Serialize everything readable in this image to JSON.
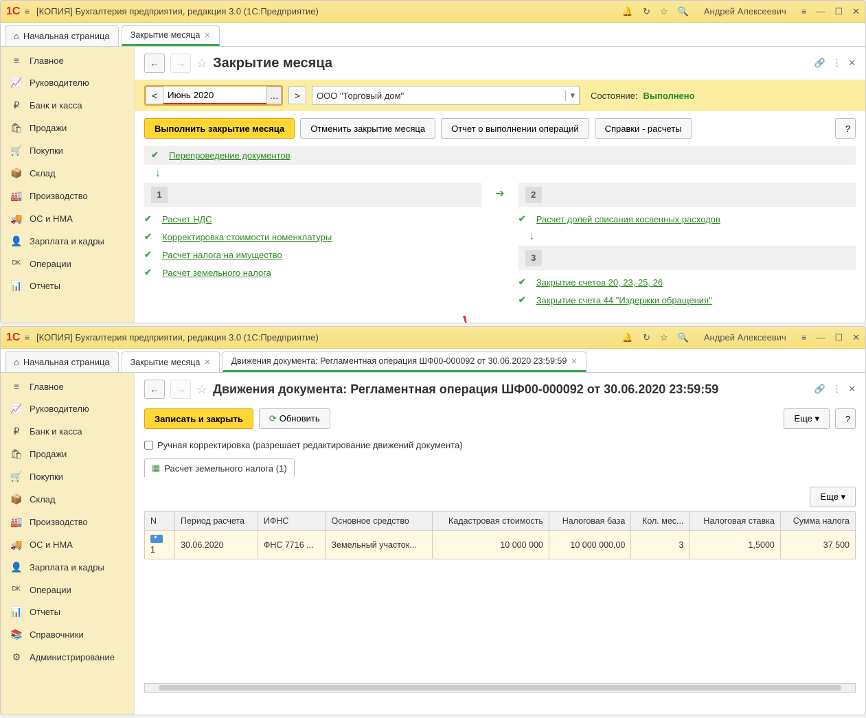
{
  "window_title": "[КОПИЯ] Бухгалтерия предприятия, редакция 3.0  (1С:Предприятие)",
  "user_name": "Андрей Алексеевич",
  "home_tab": "Начальная страница",
  "sidebar": {
    "items": [
      {
        "label": "Главное"
      },
      {
        "label": "Руководителю"
      },
      {
        "label": "Банк и касса"
      },
      {
        "label": "Продажи"
      },
      {
        "label": "Покупки"
      },
      {
        "label": "Склад"
      },
      {
        "label": "Производство"
      },
      {
        "label": "ОС и НМА"
      },
      {
        "label": "Зарплата и кадры"
      },
      {
        "label": "Операции"
      },
      {
        "label": "Отчеты"
      },
      {
        "label": "Справочники"
      },
      {
        "label": "Администрирование"
      }
    ]
  },
  "win1": {
    "tab": "Закрытие месяца",
    "page_title": "Закрытие месяца",
    "period": "Июнь 2020",
    "organization": "ООО \"Торговый дом\"",
    "status_label": "Состояние:",
    "status_value": "Выполнено",
    "buttons": {
      "execute": "Выполнить закрытие месяца",
      "cancel": "Отменить закрытие месяца",
      "report": "Отчет о выполнении операций",
      "refs": "Справки - расчеты"
    },
    "ops": {
      "reprov": "Перепроведение документов",
      "c1": {
        "o1": "Расчет НДС",
        "o2": "Корректировка стоимости номенклатуры",
        "o3": "Расчет налога на имущество",
        "o4": "Расчет земельного налога"
      },
      "c2": {
        "o1": "Расчет долей списания косвенных расходов"
      },
      "c3": {
        "o1": "Закрытие счетов 20, 23, 25, 26",
        "o2": "Закрытие счета 44 \"Издержки обращения\""
      }
    }
  },
  "win2": {
    "tab1": "Закрытие месяца",
    "tab2": "Движения документа: Регламентная операция ШФ00-000092 от 30.06.2020 23:59:59",
    "page_title": "Движения документа: Регламентная операция ШФ00-000092 от 30.06.2020 23:59:59",
    "buttons": {
      "save_close": "Записать и закрыть",
      "refresh": "Обновить",
      "more": "Еще"
    },
    "manual_checkbox": "Ручная корректировка (разрешает редактирование движений документа)",
    "subtab": "Расчет земельного налога (1)",
    "table": {
      "headers": {
        "n": "N",
        "period": "Период расчета",
        "ifns": "ИФНС",
        "asset": "Основное средство",
        "cadastral": "Кадастровая стоимость",
        "taxbase": "Налоговая база",
        "months": "Кол. мес...",
        "rate": "Налоговая ставка",
        "amount": "Сумма налога"
      },
      "row": {
        "n": "1",
        "period": "30.06.2020",
        "ifns": "ФНС 7716 ...",
        "asset": "Земельный участок...",
        "cadastral": "10 000 000",
        "taxbase": "10 000 000,00",
        "months": "3",
        "rate": "1,5000",
        "amount": "37 500"
      }
    }
  }
}
